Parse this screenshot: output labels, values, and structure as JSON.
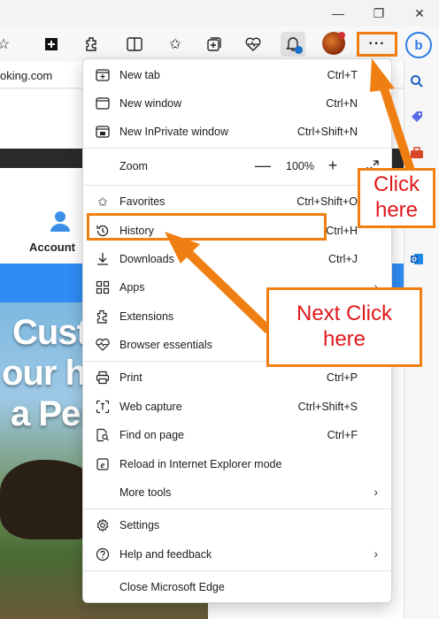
{
  "window": {
    "minimize_glyph": "—",
    "restore_glyph": "❐",
    "close_glyph": "✕"
  },
  "toolbar": {
    "more_label": "···",
    "bing_label": "b"
  },
  "bookmarks": {
    "partial_url_text": "oking.com"
  },
  "page": {
    "account_label": "Account",
    "hero_lines": [
      "Custo",
      "our ha",
      "a Per"
    ]
  },
  "menu": {
    "items": [
      {
        "label": "New tab",
        "shortcut": "Ctrl+T"
      },
      {
        "label": "New window",
        "shortcut": "Ctrl+N"
      },
      {
        "label": "New InPrivate window",
        "shortcut": "Ctrl+Shift+N"
      },
      {
        "label": "Zoom",
        "zoom_value": "100%",
        "minus": "—",
        "plus": "+"
      },
      {
        "label": "Favorites",
        "shortcut": "Ctrl+Shift+O"
      },
      {
        "label": "History",
        "shortcut": "Ctrl+H"
      },
      {
        "label": "Downloads",
        "shortcut": "Ctrl+J"
      },
      {
        "label": "Apps"
      },
      {
        "label": "Extensions"
      },
      {
        "label": "Browser essentials"
      },
      {
        "label": "Print",
        "shortcut": "Ctrl+P"
      },
      {
        "label": "Web capture",
        "shortcut": "Ctrl+Shift+S"
      },
      {
        "label": "Find on page",
        "shortcut": "Ctrl+F"
      },
      {
        "label": "Reload in Internet Explorer mode"
      },
      {
        "label": "More tools"
      },
      {
        "label": "Settings"
      },
      {
        "label": "Help and feedback"
      },
      {
        "label": "Close Microsoft Edge"
      }
    ]
  },
  "callouts": {
    "click_here": [
      "Click",
      "here"
    ],
    "next_click_here": [
      "Next Click",
      "here"
    ]
  },
  "colors": {
    "annotation_orange": "#f07f13",
    "annotation_text_red": "#e0191b",
    "edge_blue": "#2e8cf3"
  }
}
